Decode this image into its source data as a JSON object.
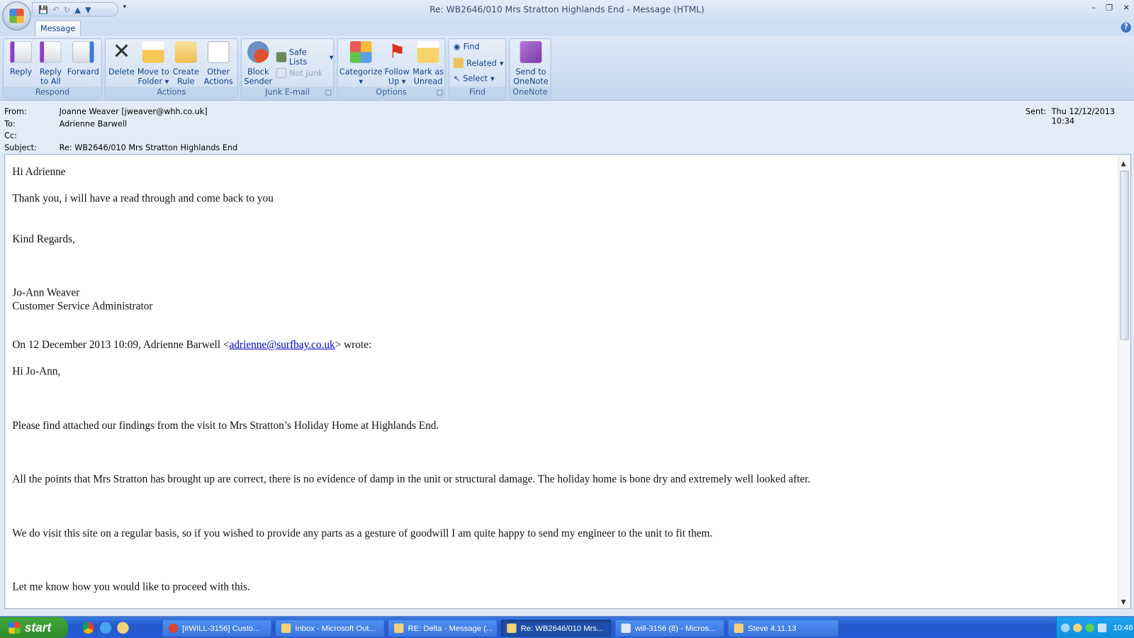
{
  "window": {
    "title": "Re: WB2646/010 Mrs Stratton Highlands End - Message (HTML)"
  },
  "ribbon": {
    "tab": "Message",
    "groups": {
      "respond": "Respond",
      "actions": "Actions",
      "junk": "Junk E-mail",
      "options": "Options",
      "find": "Find",
      "onenote": "OneNote"
    },
    "reply": "Reply",
    "reply_all_1": "Reply",
    "reply_all_2": "to All",
    "forward": "Forward",
    "delete": "Delete",
    "move_1": "Move to",
    "move_2": "Folder",
    "create_1": "Create",
    "create_2": "Rule",
    "other_1": "Other",
    "other_2": "Actions",
    "block_1": "Block",
    "block_2": "Sender",
    "safe_lists": "Safe Lists",
    "not_junk": "Not Junk",
    "categorize": "Categorize",
    "follow_1": "Follow",
    "follow_2": "Up",
    "mark_1": "Mark as",
    "mark_2": "Unread",
    "find": "Find",
    "related": "Related",
    "select": "Select",
    "onenote_1": "Send to",
    "onenote_2": "OneNote"
  },
  "header": {
    "from_label": "From:",
    "from": "Joanne Weaver [jweaver@whh.co.uk]",
    "to_label": "To:",
    "to": "Adrienne Barwell",
    "cc_label": "Cc:",
    "cc": "",
    "subject_label": "Subject:",
    "subject": "Re: WB2646/010 Mrs Stratton Highlands End",
    "sent_label": "Sent:",
    "sent": "Thu 12/12/2013 10:34"
  },
  "body": {
    "greeting": "Hi Adrienne",
    "line1": "Thank you, i will have a read through and come back to you",
    "regards": "Kind Regards,",
    "sig_name": "Jo-Ann Weaver",
    "sig_title": "Customer Service Administrator",
    "quote_pre": "On 12 December 2013 10:09, Adrienne Barwell <",
    "quote_email": "adrienne@surfbay.co.uk",
    "quote_post": "> wrote:",
    "q_greeting": "Hi Jo-Ann,",
    "q1": "Please find attached our findings from the visit to Mrs Stratton’s Holiday Home at Highlands End.",
    "q2": "All the points that Mrs Stratton has brought up are correct, there is no evidence of damp in the unit or structural damage.   The holiday home is bone dry and extremely well looked after.",
    "q3": "We do visit this site on a regular basis, so if you wished to provide any  parts as a gesture of goodwill I am quite happy to send my engineer to the unit to fit them.",
    "q4": "Let me know how you would like to proceed with this."
  },
  "taskbar": {
    "start": "start",
    "tasks": [
      "[#WILL-3156] Custo...",
      "Inbox - Microsoft Out...",
      "RE: Delta - Message (...",
      "Re: WB2646/010 Mrs...",
      "will-3156 (8) - Micros...",
      "Steve 4.11.13"
    ],
    "clock": "10:48"
  }
}
